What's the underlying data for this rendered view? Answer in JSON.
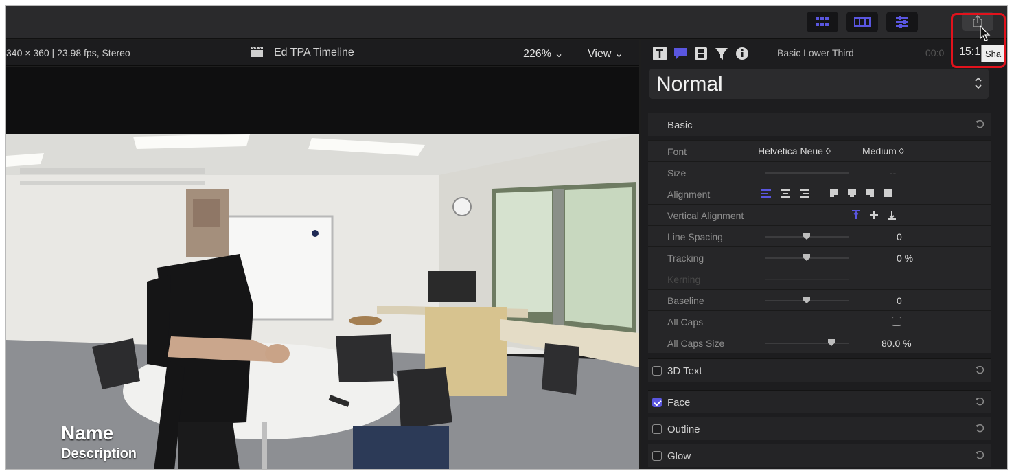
{
  "toolbar": {
    "buttons": [
      {
        "icon": "browser-grid-icon"
      },
      {
        "icon": "timeline-icon"
      },
      {
        "icon": "inspector-sliders-icon"
      }
    ],
    "share_icon": "share-icon",
    "tooltip": "Sha"
  },
  "viewer": {
    "format": "340 × 360 | 23.98 fps, Stereo",
    "project_title": "Ed TPA Timeline",
    "zoom": "226% ⌄",
    "view_menu": "View ⌄",
    "lower_third": {
      "name": "Name",
      "description": "Description"
    }
  },
  "inspector": {
    "clip_name": "Basic Lower Third",
    "timecode_dim": "00:0",
    "timecode": "15:1",
    "preset": "Normal",
    "sections": {
      "basic": "Basic",
      "text3d": "3D Text",
      "face": "Face",
      "outline": "Outline",
      "glow": "Glow"
    },
    "params": {
      "font_label": "Font",
      "font_value": "Helvetica Neue ◊",
      "weight_value": "Medium ◊",
      "size_label": "Size",
      "size_value": "--",
      "alignment_label": "Alignment",
      "valign_label": "Vertical Alignment",
      "line_spacing_label": "Line Spacing",
      "line_spacing_value": "0",
      "tracking_label": "Tracking",
      "tracking_value": "0 %",
      "kerning_label": "Kerning",
      "baseline_label": "Baseline",
      "baseline_value": "0",
      "allcaps_label": "All Caps",
      "allcaps_size_label": "All Caps Size",
      "allcaps_size_value": "80.0 %"
    },
    "face_checked": true,
    "accent_color": "#5a56e0"
  }
}
